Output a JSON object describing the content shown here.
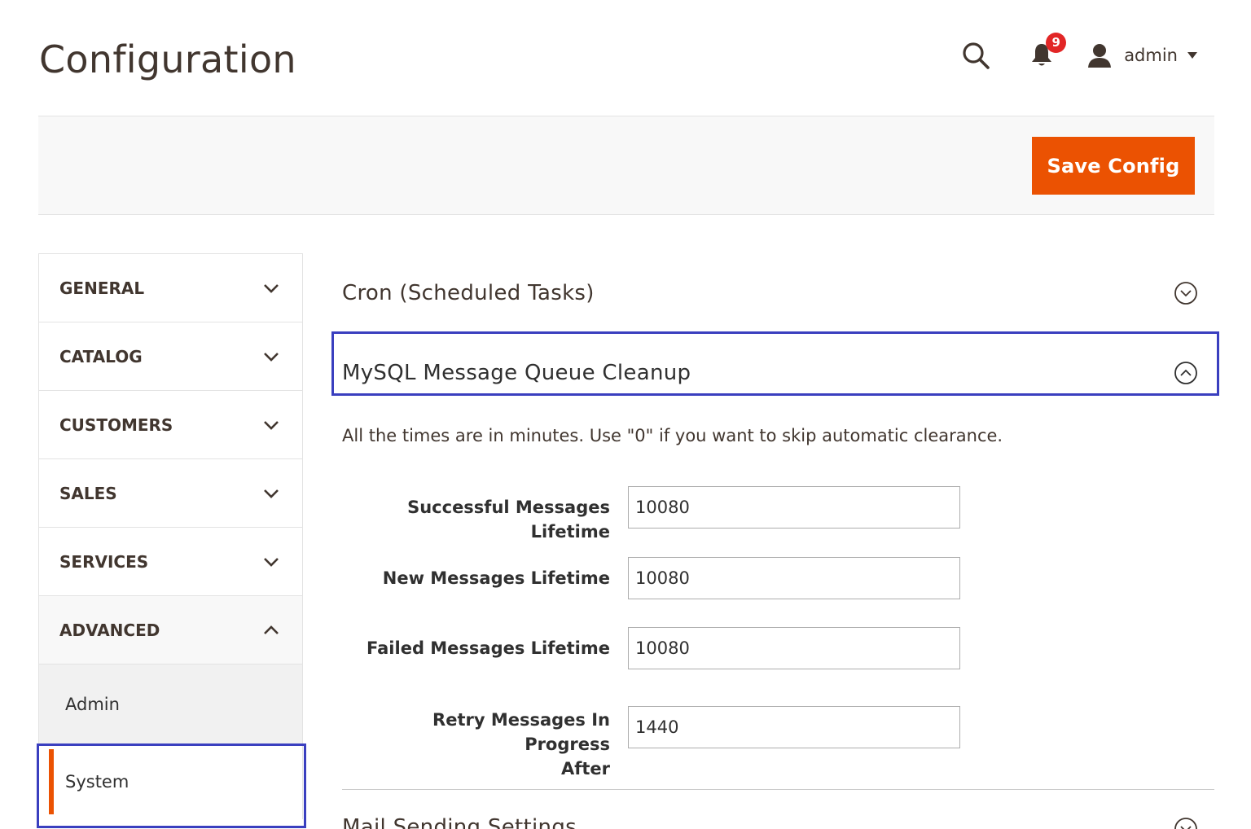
{
  "header": {
    "title": "Configuration",
    "notifications_count": "9",
    "user_name": "admin"
  },
  "action_bar": {
    "save_label": "Save Config"
  },
  "sidebar": {
    "tabs": [
      {
        "label": "GENERAL",
        "expanded": false
      },
      {
        "label": "CATALOG",
        "expanded": false
      },
      {
        "label": "CUSTOMERS",
        "expanded": false
      },
      {
        "label": "SALES",
        "expanded": false
      },
      {
        "label": "SERVICES",
        "expanded": false
      },
      {
        "label": "ADVANCED",
        "expanded": true
      }
    ],
    "subtabs": [
      {
        "label": "Admin",
        "selected": false
      },
      {
        "label": "System",
        "selected": true
      }
    ]
  },
  "main": {
    "sections": [
      {
        "title": "Cron (Scheduled Tasks)",
        "open": false
      },
      {
        "title": "MySQL Message Queue Cleanup",
        "open": true
      },
      {
        "title": "Mail Sending Settings",
        "open": false
      }
    ],
    "comment": "All the times are in minutes. Use \"0\" if you want to skip automatic clearance.",
    "fields": [
      {
        "label": "Successful Messages Lifetime",
        "value": "10080"
      },
      {
        "label": "New Messages Lifetime",
        "value": "10080"
      },
      {
        "label": "Failed Messages Lifetime",
        "value": "10080"
      },
      {
        "label_line1": "Retry Messages In Progress",
        "label_line2": "After",
        "value": "1440"
      }
    ]
  },
  "colors": {
    "accent": "#eb5202",
    "badge": "#e22626",
    "highlight": "#3a3fbf"
  }
}
